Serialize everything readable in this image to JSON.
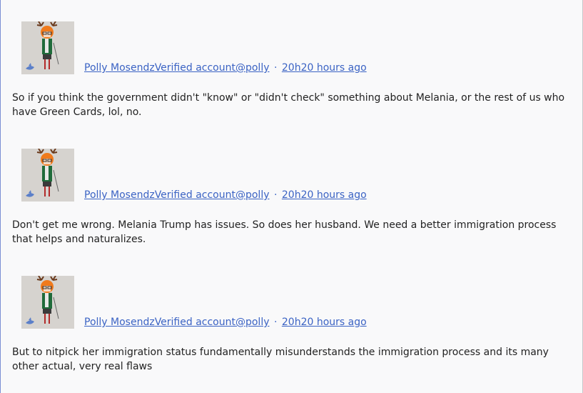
{
  "tweets": [
    {
      "author_name": "Polly Mosendz",
      "verified_label": "Verified account",
      "handle": "@polly",
      "separator": "·",
      "time": "20h20 hours ago",
      "text": "So if you think the government didn't \"know\" or \"didn't check\" something about Melania, or the rest of us who have Green Cards, lol, no."
    },
    {
      "author_name": "Polly Mosendz",
      "verified_label": "Verified account",
      "handle": "@polly",
      "separator": "·",
      "time": "20h20 hours ago",
      "text": "Don't get me wrong. Melania Trump has issues. So does her husband. We need a better immigration process that helps and naturalizes."
    },
    {
      "author_name": "Polly Mosendz",
      "verified_label": "Verified account",
      "handle": "@polly",
      "separator": "·",
      "time": "20h20 hours ago",
      "text": "But to nitpick her immigration status fundamentally misunderstands the immigration process and its many other actual, very real flaws"
    }
  ],
  "colors": {
    "link": "#3b63c4",
    "background": "#f9f9fa",
    "left_border": "#7b8fd4",
    "text": "#222222"
  },
  "icons": {
    "avatar": "avatar-illustration"
  }
}
